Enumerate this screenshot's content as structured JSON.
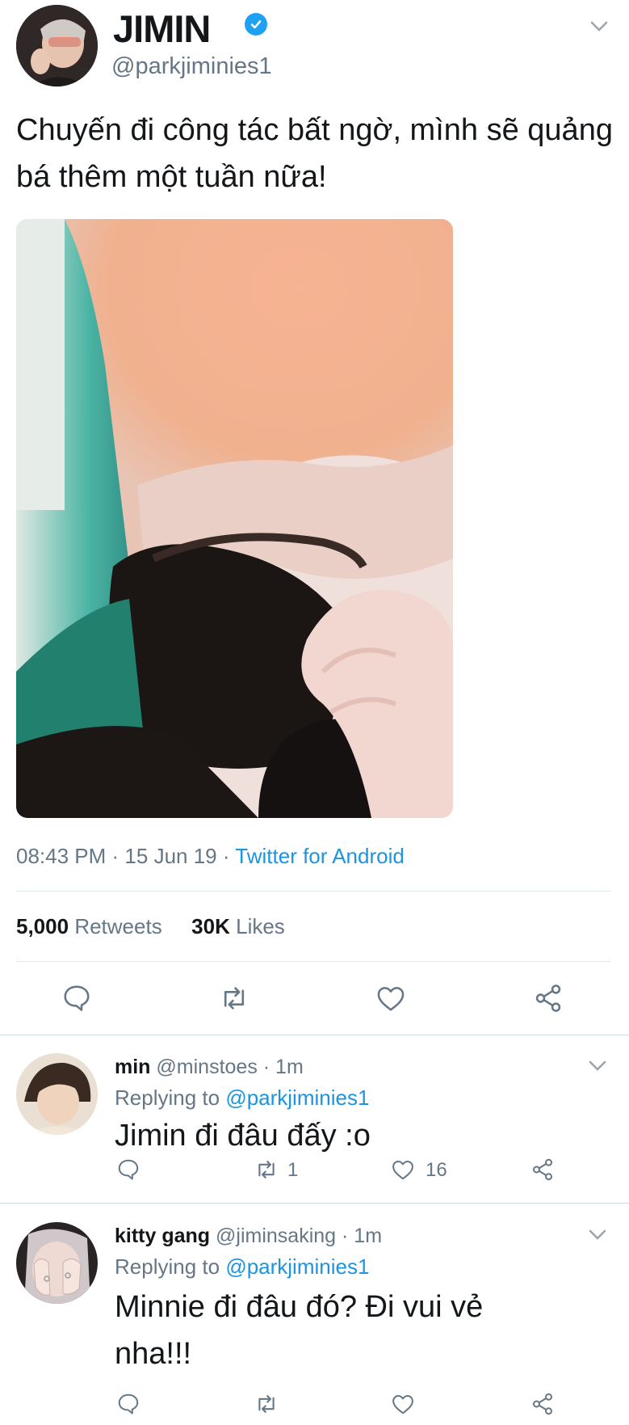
{
  "tweet": {
    "author_name": "JIMIN",
    "handle": "@parkjiminies1",
    "text": "Chuyến đi công tác bất ngờ, mình sẽ quảng bá thêm một tuần nữa!",
    "time": "08:43 PM",
    "date": "15 Jun 19",
    "client": "Twitter for Android",
    "retweet_count": "5,000",
    "retweet_label": "Retweets",
    "like_count": "30K",
    "like_label": "Likes",
    "icons": [
      "avatar",
      "verified-badge-icon",
      "chevron-down-icon",
      "reply-icon",
      "retweet-icon",
      "like-icon",
      "share-icon"
    ]
  },
  "replies": [
    {
      "name": "min",
      "handle": "@minstoes",
      "age": "1m",
      "replying_prefix": "Replying to",
      "replying_to": "@parkjiminies1",
      "text": "Jimin đi đâu đấy :o",
      "retweets": "1",
      "likes": "16"
    },
    {
      "name": "kitty gang",
      "handle": "@jiminsaking",
      "age": "1m",
      "replying_prefix": "Replying to",
      "replying_to": "@parkjiminies1",
      "text": "Minnie đi đâu đó? Đi vui vẻ nha!!!",
      "retweets": "",
      "likes": ""
    }
  ],
  "colors": {
    "link": "#1b95e0",
    "muted": "#657786",
    "text": "#14171a",
    "divider": "#e1e8ed",
    "verified": "#1da1f2"
  }
}
